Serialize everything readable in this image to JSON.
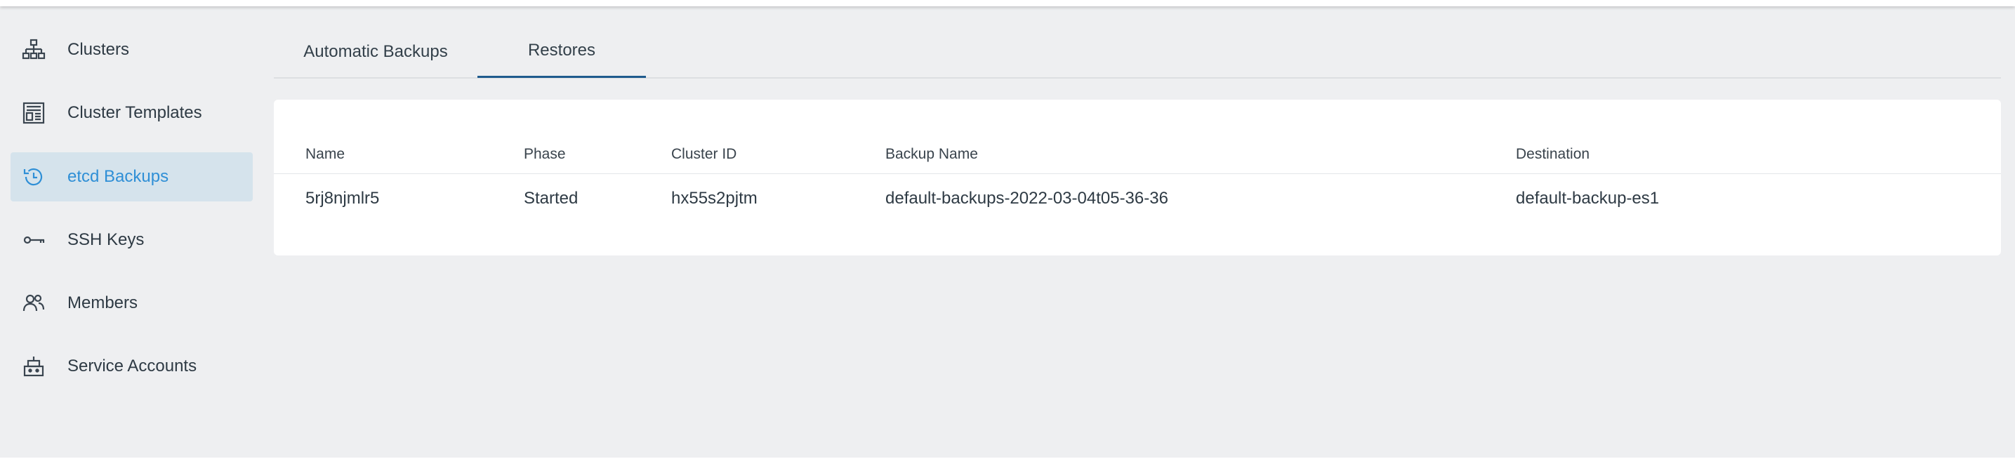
{
  "sidebar": {
    "items": [
      {
        "label": "Clusters",
        "icon": "sitemap-icon",
        "active": false
      },
      {
        "label": "Cluster Templates",
        "icon": "template-icon",
        "active": false
      },
      {
        "label": "etcd Backups",
        "icon": "history-icon",
        "active": true
      },
      {
        "label": "SSH Keys",
        "icon": "key-icon",
        "active": false
      },
      {
        "label": "Members",
        "icon": "users-icon",
        "active": false
      },
      {
        "label": "Service Accounts",
        "icon": "robot-icon",
        "active": false
      }
    ]
  },
  "tabs": [
    {
      "label": "Automatic Backups",
      "active": false
    },
    {
      "label": "Restores",
      "active": true
    }
  ],
  "table": {
    "columns": [
      "Name",
      "Phase",
      "Cluster ID",
      "Backup Name",
      "Destination"
    ],
    "rows": [
      {
        "name": "5rj8njmlr5",
        "phase": "Started",
        "cluster_id": "hx55s2pjtm",
        "backup_name": "default-backups-2022-03-04t05-36-36",
        "destination": "default-backup-es1"
      }
    ]
  },
  "colors": {
    "accent": "#2f8fd6",
    "active_bg": "#d5e3ec",
    "tab_underline": "#1f5b8e",
    "page_bg": "#eeeff1"
  }
}
